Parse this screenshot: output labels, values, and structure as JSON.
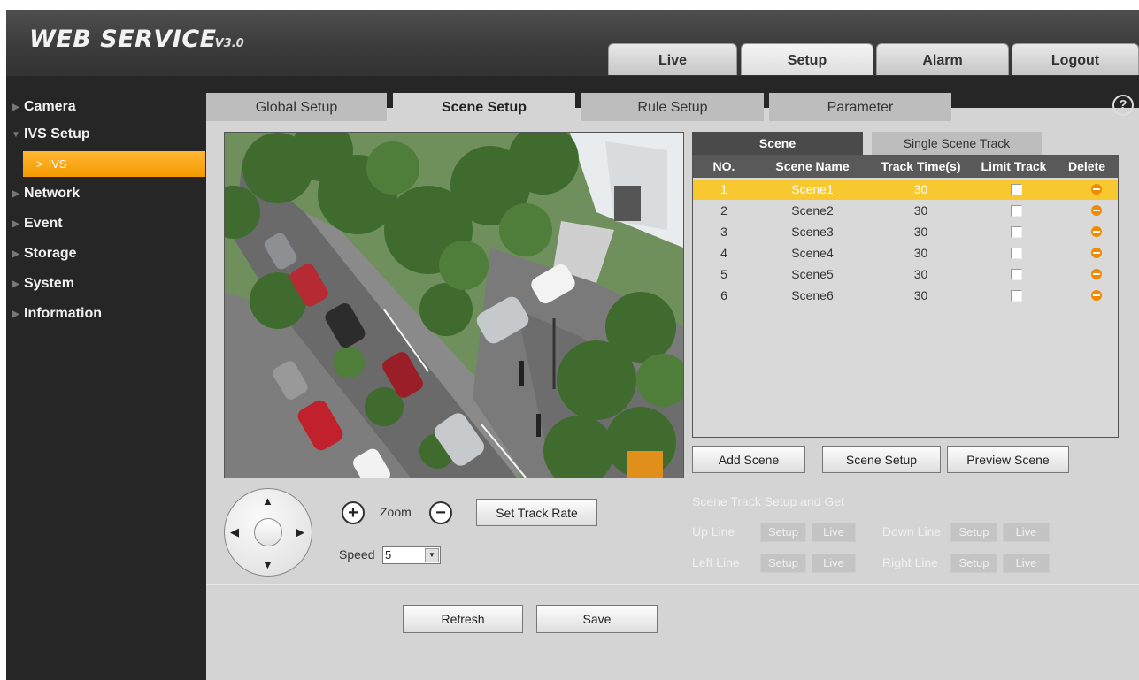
{
  "header": {
    "logo": "WEB SERVICE",
    "logo_version": "V3.0",
    "tabs": [
      {
        "label": "Live"
      },
      {
        "label": "Setup"
      },
      {
        "label": "Alarm"
      },
      {
        "label": "Logout"
      }
    ],
    "active_tab": "Setup"
  },
  "sidebar": {
    "items": [
      {
        "label": "Camera",
        "expanded": false
      },
      {
        "label": "IVS Setup",
        "expanded": true
      },
      {
        "label": "Network",
        "expanded": false
      },
      {
        "label": "Event",
        "expanded": false
      },
      {
        "label": "Storage",
        "expanded": false
      },
      {
        "label": "System",
        "expanded": false
      },
      {
        "label": "Information",
        "expanded": false
      }
    ],
    "sub_item": {
      "arrow": ">",
      "label": "IVS"
    }
  },
  "subtabs": [
    {
      "label": "Global Setup"
    },
    {
      "label": "Scene Setup"
    },
    {
      "label": "Rule Setup"
    },
    {
      "label": "Parameter"
    }
  ],
  "active_subtab": "Scene Setup",
  "help_icon": "?",
  "ptz": {
    "zoom_in": "+",
    "zoom_label": "Zoom",
    "zoom_out": "−",
    "set_track_rate": "Set Track Rate",
    "speed_label": "Speed",
    "speed_value": "5"
  },
  "scene_panel": {
    "tabs": [
      {
        "label": "Scene"
      },
      {
        "label": "Single Scene Track"
      }
    ],
    "active_tab": "Scene",
    "columns": [
      "NO.",
      "Scene Name",
      "Track Time(s)",
      "Limit Track",
      "Delete"
    ],
    "rows": [
      {
        "no": "1",
        "name": "Scene1",
        "time": "30",
        "limit": false,
        "selected": true
      },
      {
        "no": "2",
        "name": "Scene2",
        "time": "30",
        "limit": false,
        "selected": false
      },
      {
        "no": "3",
        "name": "Scene3",
        "time": "30",
        "limit": false,
        "selected": false
      },
      {
        "no": "4",
        "name": "Scene4",
        "time": "30",
        "limit": false,
        "selected": false
      },
      {
        "no": "5",
        "name": "Scene5",
        "time": "30",
        "limit": false,
        "selected": false
      },
      {
        "no": "6",
        "name": "Scene6",
        "time": "30",
        "limit": false,
        "selected": false
      }
    ],
    "add_scene": "Add Scene",
    "scene_setup": "Scene Setup",
    "preview_scene": "Preview Scene"
  },
  "track_setup": {
    "title": "Scene Track Setup and Get",
    "up_line": "Up Line",
    "down_line": "Down Line",
    "left_line": "Left Line",
    "right_line": "Right Line",
    "setup": "Setup",
    "live": "Live"
  },
  "footer": {
    "refresh": "Refresh",
    "save": "Save"
  },
  "colors": {
    "sidebar_active": "#f49a00",
    "selected_row": "#f7c830",
    "delete_icon": "#f08a00"
  }
}
